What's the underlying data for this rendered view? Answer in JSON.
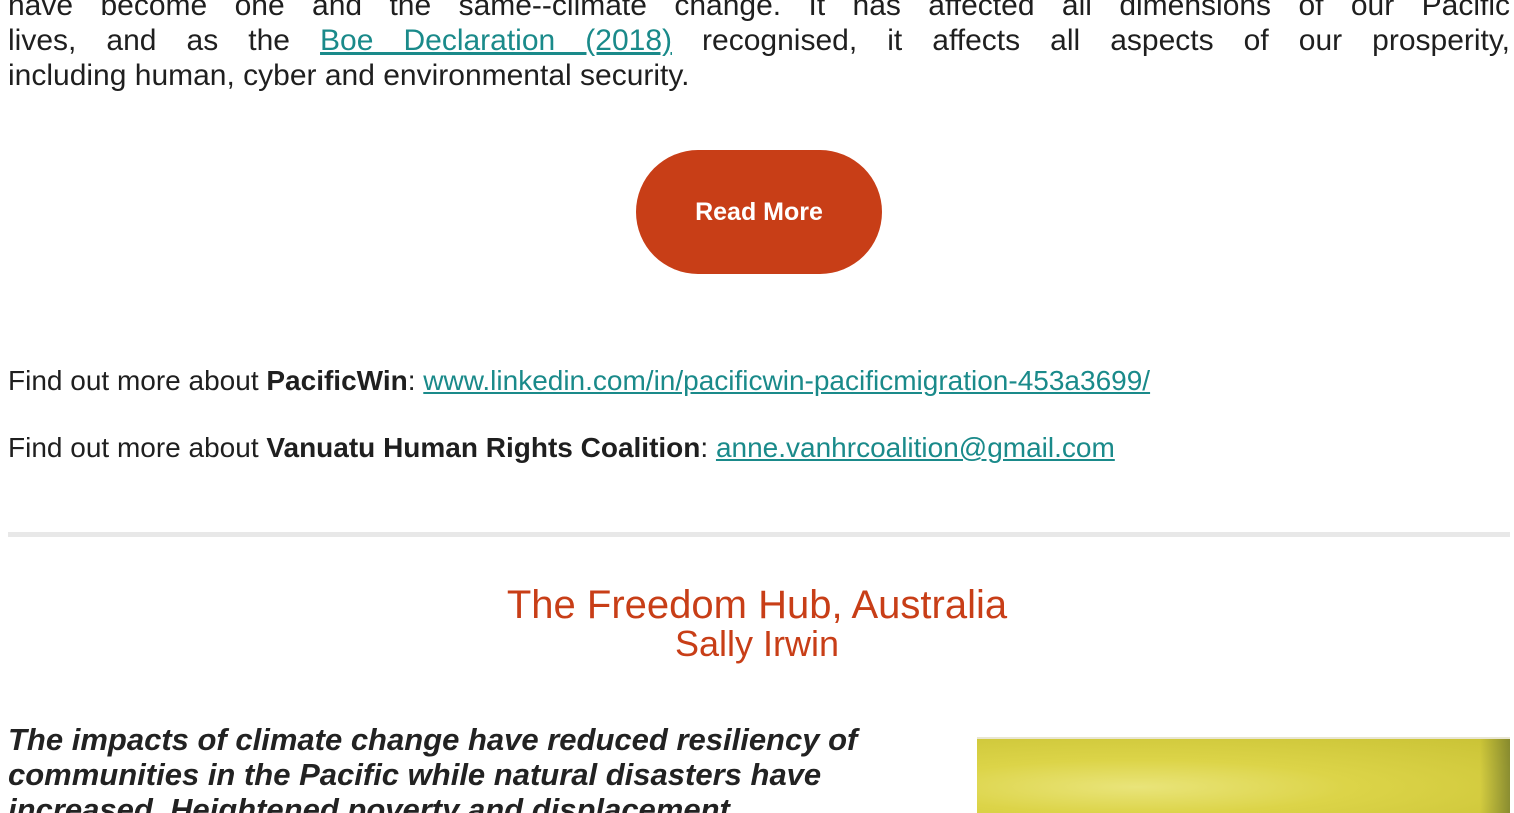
{
  "article": {
    "line1": "have become one and the same--climate change. It has affected all dimensions of our Pacific",
    "line2_pre": "lives, and as the ",
    "line2_link": "Boe Declaration (2018)",
    "line2_post": " recognised, it affects all aspects of our prosperity,",
    "line3": "including human, cyber and environmental security.",
    "read_more_label": "Read More"
  },
  "find_out": {
    "row1_pre": "Find out more about ",
    "row1_bold": "PacificWin",
    "row1_sep": ": ",
    "row1_link": "www.linkedin.com/in/pacificwin-pacificmigration-453a3699/",
    "row2_pre": "Find out more about ",
    "row2_bold": "Vanuatu Human Rights Coalition",
    "row2_sep": ": ",
    "row2_link": "anne.vanhrcoalition@gmail.com"
  },
  "next_section": {
    "title": "The Freedom Hub, Australia",
    "author": "Sally Irwin",
    "quote": "The impacts of climate change have reduced resiliency of communities in the Pacific while natural disasters have increased. Heightened poverty and displacement",
    "title_color": "#c83e17"
  },
  "colors": {
    "button_bg": "#c83e17",
    "link": "#1a8a8a",
    "divider": "#e8e8e8"
  }
}
